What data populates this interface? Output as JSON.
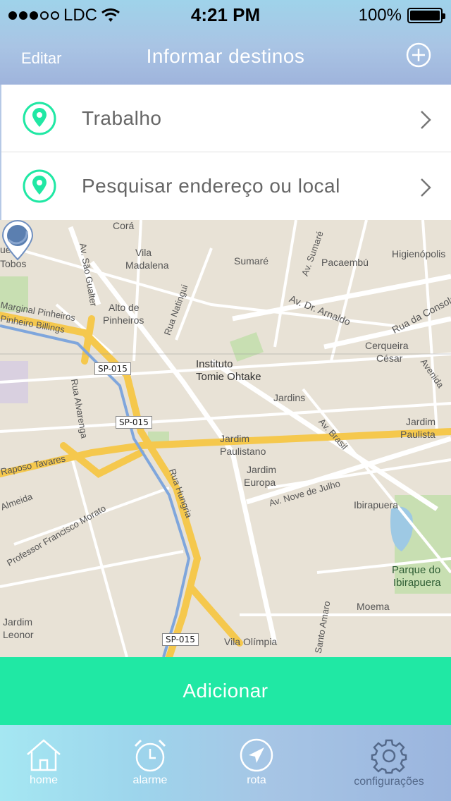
{
  "status_bar": {
    "carrier": "LDC",
    "time": "4:21 PM",
    "battery": "100%"
  },
  "nav": {
    "edit": "Editar",
    "title": "Informar destinos",
    "add_icon": "plus-circle-icon"
  },
  "destinations": [
    {
      "label": "Trabalho",
      "icon": "location-pin-icon"
    },
    {
      "label": "Pesquisar endereço ou local",
      "icon": "location-pin-icon"
    }
  ],
  "map": {
    "labels": [
      "Corá",
      "Vila",
      "Madalena",
      "Sumaré",
      "Pacaembú",
      "Higienópolis",
      "Av. Sumaré",
      "Av. São Gualter",
      "Alto de",
      "Pinheiros",
      "Rua Natingui",
      "Av. Dr. Arnaldo",
      "Rua da Consolação",
      "Marginal Pinheiros",
      "Pinheiro Billings",
      "Cerqueira",
      "César",
      "Instituto",
      "Tomie Ohtake",
      "Jardins",
      "Avenida",
      "Rua Alvarenga",
      "Jardim",
      "Paulista",
      "Av. Brasil",
      "Jardim",
      "Paulistano",
      "Jardim",
      "Europa",
      "Av. Nove de Julho",
      "Raposo Tavares",
      "Rua Hungria",
      "Ibirapuera",
      "Almeida",
      "Professor Francisco Morato",
      "Parque do",
      "Ibirapuera",
      "Moema",
      "Jardim",
      "Leonor",
      "Vila Olímpia",
      "Santo Amaro",
      "Tobos",
      "ue"
    ],
    "shields": [
      "SP-015",
      "SP-015",
      "SP-015"
    ]
  },
  "add_button": "Adicionar",
  "tabs": [
    {
      "label": "home",
      "icon": "home-icon"
    },
    {
      "label": "alarme",
      "icon": "alarm-clock-icon"
    },
    {
      "label": "rota",
      "icon": "navigation-arrow-icon"
    },
    {
      "label": "configurações",
      "icon": "gear-icon"
    }
  ],
  "colors": {
    "accent": "#20e8a4",
    "header": "#a9c4e4",
    "map_background": "#e8e2d6",
    "road_major": "#f5c84d"
  }
}
